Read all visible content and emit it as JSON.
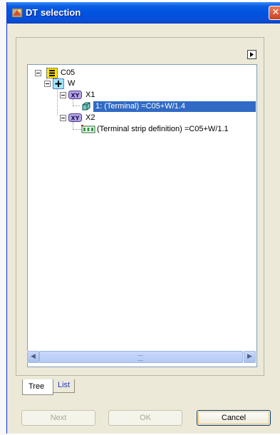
{
  "window": {
    "title": "DT selection",
    "close_glyph": "✕"
  },
  "panel": {
    "expand_icon": "triangle-right-icon"
  },
  "tree": {
    "nodes": [
      {
        "label": "C05",
        "icon": "yellow-list-icon",
        "expanded": true
      },
      {
        "label": "W",
        "icon": "blue-plus-box-icon",
        "expanded": true
      },
      {
        "label": "X1",
        "icon": "xy-icon",
        "expanded": true
      },
      {
        "label": "1: (Terminal) =C05+W/1.4",
        "icon": "terminal-3d-icon",
        "selected": true
      },
      {
        "label": "X2",
        "icon": "xy-icon",
        "expanded": true
      },
      {
        "label": "(Terminal strip definition) =C05+W/1.1",
        "icon": "terminal-strip-icon",
        "selected": false
      }
    ]
  },
  "scrollbar": {
    "left_arrow": "◀",
    "right_arrow": "▶"
  },
  "tabs": [
    {
      "label": "Tree",
      "active": true
    },
    {
      "label": "List",
      "active": false
    }
  ],
  "buttons": {
    "next": "Next",
    "ok": "OK",
    "cancel": "Cancel"
  },
  "colors": {
    "title_bar": "#0053df",
    "selection": "#316ac5",
    "dialog_bg": "#ece9d8"
  }
}
